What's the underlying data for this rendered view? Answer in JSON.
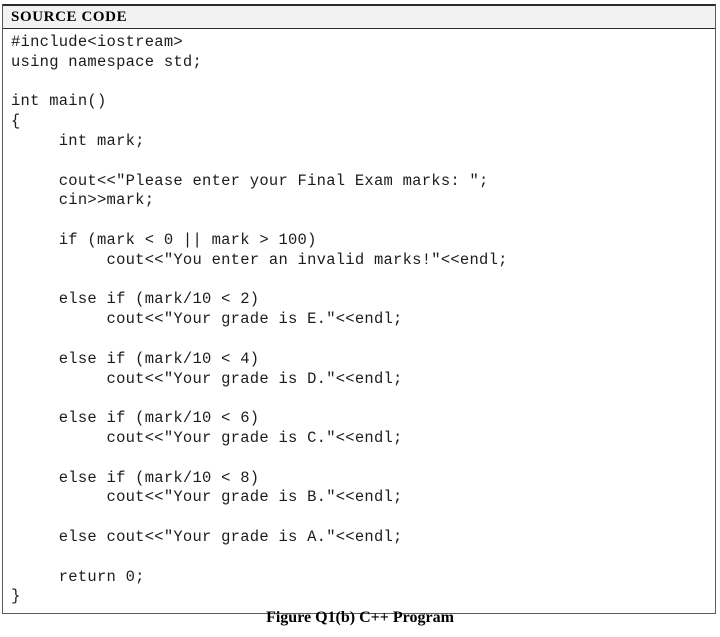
{
  "figure": {
    "table_header": "SOURCE CODE",
    "caption": "Figure Q1(b) C++ Program",
    "language": "C++",
    "colors": {
      "header_fill": "#f2f2f2",
      "border": "#5a5a5a",
      "border_top": "#2b2b2b",
      "code_text": "#1c1c1c",
      "page_background": "#ffffff"
    },
    "code_lines": [
      "#include<iostream>",
      "using namespace std;",
      "",
      "int main()",
      "{",
      "     int mark;",
      "",
      "     cout<<\"Please enter your Final Exam marks: \";",
      "     cin>>mark;",
      "",
      "     if (mark < 0 || mark > 100)",
      "          cout<<\"You enter an invalid marks!\"<<endl;",
      "",
      "     else if (mark/10 < 2)",
      "          cout<<\"Your grade is E.\"<<endl;",
      "",
      "     else if (mark/10 < 4)",
      "          cout<<\"Your grade is D.\"<<endl;",
      "",
      "     else if (mark/10 < 6)",
      "          cout<<\"Your grade is C.\"<<endl;",
      "",
      "     else if (mark/10 < 8)",
      "          cout<<\"Your grade is B.\"<<endl;",
      "",
      "     else cout<<\"Your grade is A.\"<<endl;",
      "",
      "     return 0;",
      "}"
    ]
  }
}
